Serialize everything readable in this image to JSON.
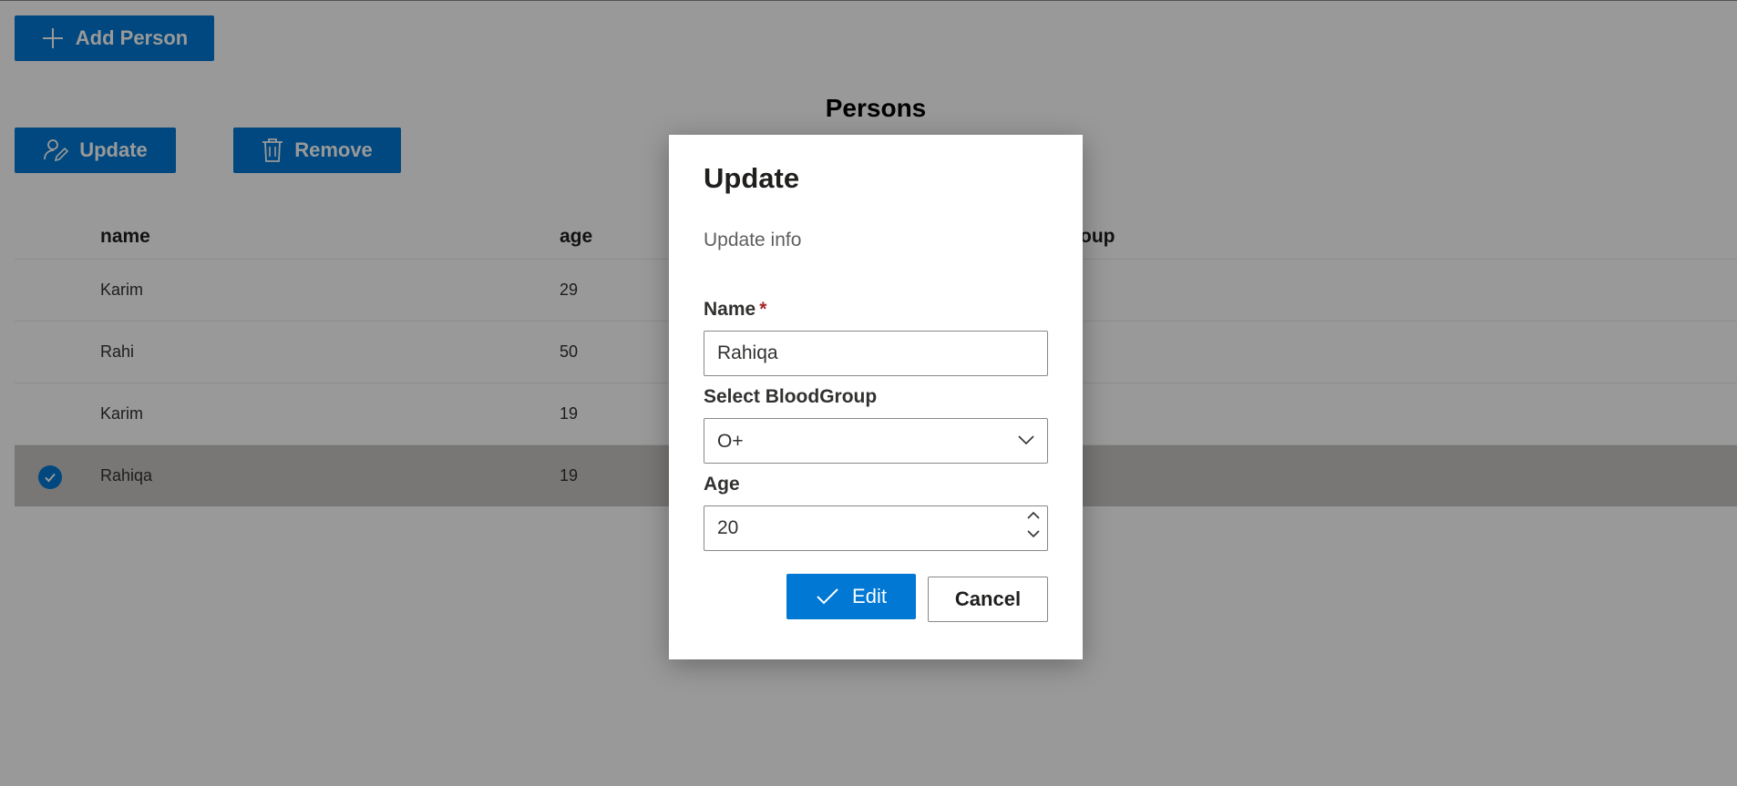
{
  "toolbar": {
    "add_label": "Add Person",
    "update_label": "Update",
    "remove_label": "Remove"
  },
  "page_title": "Persons",
  "table": {
    "columns": [
      "name",
      "age",
      "group"
    ],
    "rows": [
      {
        "name": "Karim",
        "age": "29",
        "selected": false
      },
      {
        "name": "Rahi",
        "age": "50",
        "selected": false
      },
      {
        "name": "Karim",
        "age": "19",
        "selected": false
      },
      {
        "name": "Rahiqa",
        "age": "19",
        "selected": true
      }
    ]
  },
  "dialog": {
    "title": "Update",
    "subtitle": "Update info",
    "name_label": "Name",
    "required_mark": "*",
    "name_value": "Rahiqa",
    "blood_label": "Select BloodGroup",
    "blood_value": "O+",
    "age_label": "Age",
    "age_value": "20",
    "edit_label": "Edit",
    "cancel_label": "Cancel"
  },
  "icons": {
    "add": "plus-icon",
    "update": "person-edit-icon",
    "remove": "trash-icon",
    "dropdown": "chevron-down-icon",
    "spin_up": "chevron-up-icon",
    "spin_down": "chevron-down-icon",
    "edit": "checkmark-icon",
    "row_selected": "check-circle-icon"
  },
  "colors": {
    "accent": "#0078d4",
    "required": "#a4262c",
    "selected_row": "#c8c6c4"
  }
}
